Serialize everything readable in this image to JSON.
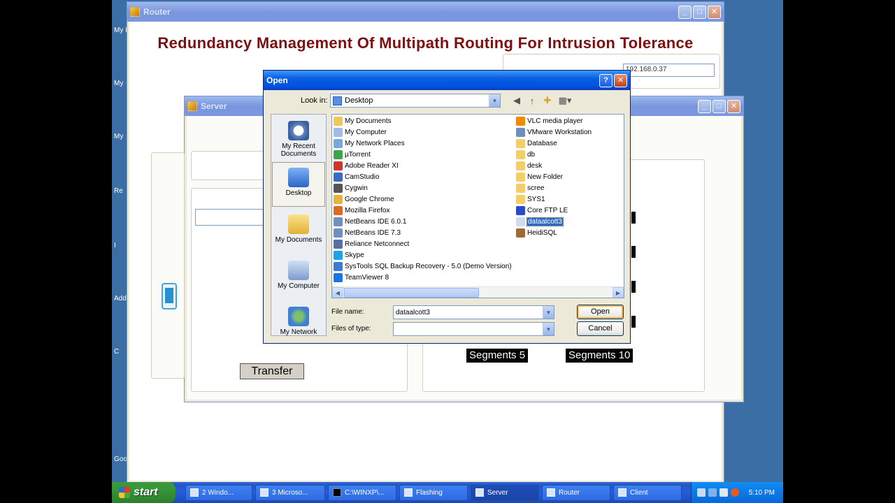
{
  "desktop": {
    "side_labels": [
      "My I",
      "My",
      "My",
      "Re",
      "I",
      "Add",
      "C",
      "Goo"
    ]
  },
  "router": {
    "title": "Router",
    "heading": "Redundancy Management Of Multipath Routing For Intrusion Tolerance",
    "ip_value": "192.168.0.37"
  },
  "server": {
    "title": "Server",
    "transfer_label": "Transfer",
    "segments5_label": "Segments 5",
    "segments10_label": "Segments 10"
  },
  "open_dialog": {
    "title": "Open",
    "look_in_label": "Look in:",
    "look_in_value": "Desktop",
    "places": [
      {
        "label": "My Recent Documents"
      },
      {
        "label": "Desktop"
      },
      {
        "label": "My Documents"
      },
      {
        "label": "My Computer"
      },
      {
        "label": "My Network"
      }
    ],
    "files_col1": [
      "My Documents",
      "My Computer",
      "My Network Places",
      "µTorrent",
      "Adobe Reader XI",
      "CamStudio",
      "Cygwin",
      "Google Chrome",
      "Mozilla Firefox",
      "NetBeans IDE 6.0.1",
      "NetBeans IDE 7.3",
      "Reliance Netconnect",
      "Skype",
      "SysTools SQL Backup Recovery - 5.0 (Demo Version)",
      "TeamViewer 8"
    ],
    "files_col2": [
      "VLC media player",
      "VMware Workstation",
      "Database",
      "db",
      "desk",
      "New Folder",
      "scree",
      "SYS1",
      "Core FTP LE",
      "dataalcott3",
      "HeidiSQL"
    ],
    "selected_file": "dataalcott3",
    "file_name_label": "File name:",
    "file_name_value": "dataalcott3",
    "files_of_type_label": "Files of type:",
    "files_of_type_value": "",
    "open_label": "Open",
    "cancel_label": "Cancel"
  },
  "taskbar": {
    "start_label": "start",
    "tasks": [
      "2 Windo...",
      "3 Microso...",
      "C:\\WINXP\\...",
      "Flashing",
      "Server",
      "Router",
      "Client"
    ],
    "clock": "5:10 PM"
  },
  "colors": {
    "accent": "#0053e1",
    "router_heading": "#7b1010",
    "selection": "#316ac5"
  }
}
